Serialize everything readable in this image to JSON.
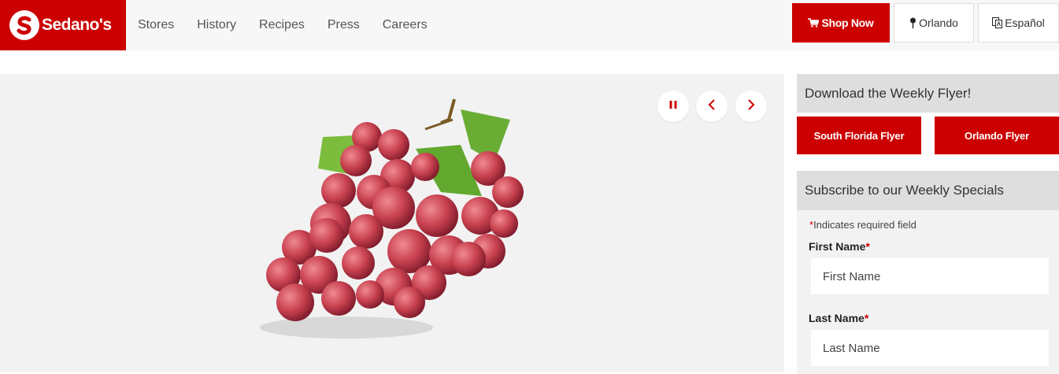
{
  "brand": {
    "name": "Sedano's"
  },
  "nav": {
    "items": [
      "Stores",
      "History",
      "Recipes",
      "Press",
      "Careers"
    ]
  },
  "header_buttons": {
    "shop": "Shop Now",
    "location": "Orlando",
    "language": "Español"
  },
  "hero": {
    "image": "red-grapes-bunch",
    "controls": [
      "pause-icon",
      "chevron-left-icon",
      "chevron-right-icon"
    ]
  },
  "flyer": {
    "heading": "Download the Weekly Flyer!",
    "buttons": [
      "South Florida Flyer",
      "Orlando Flyer"
    ]
  },
  "subscribe": {
    "heading": "Subscribe to our Weekly Specials",
    "required_note": "Indicates required field",
    "required_mark": "*",
    "first_name": {
      "label": "First Name",
      "placeholder": "First Name"
    },
    "last_name": {
      "label": "Last Name",
      "placeholder": "Last Name"
    }
  },
  "colors": {
    "brand_red": "#cc0000",
    "header_bg": "#f7f7f7",
    "panel_bg": "#dedede",
    "hero_bg": "#f2f2f2"
  }
}
